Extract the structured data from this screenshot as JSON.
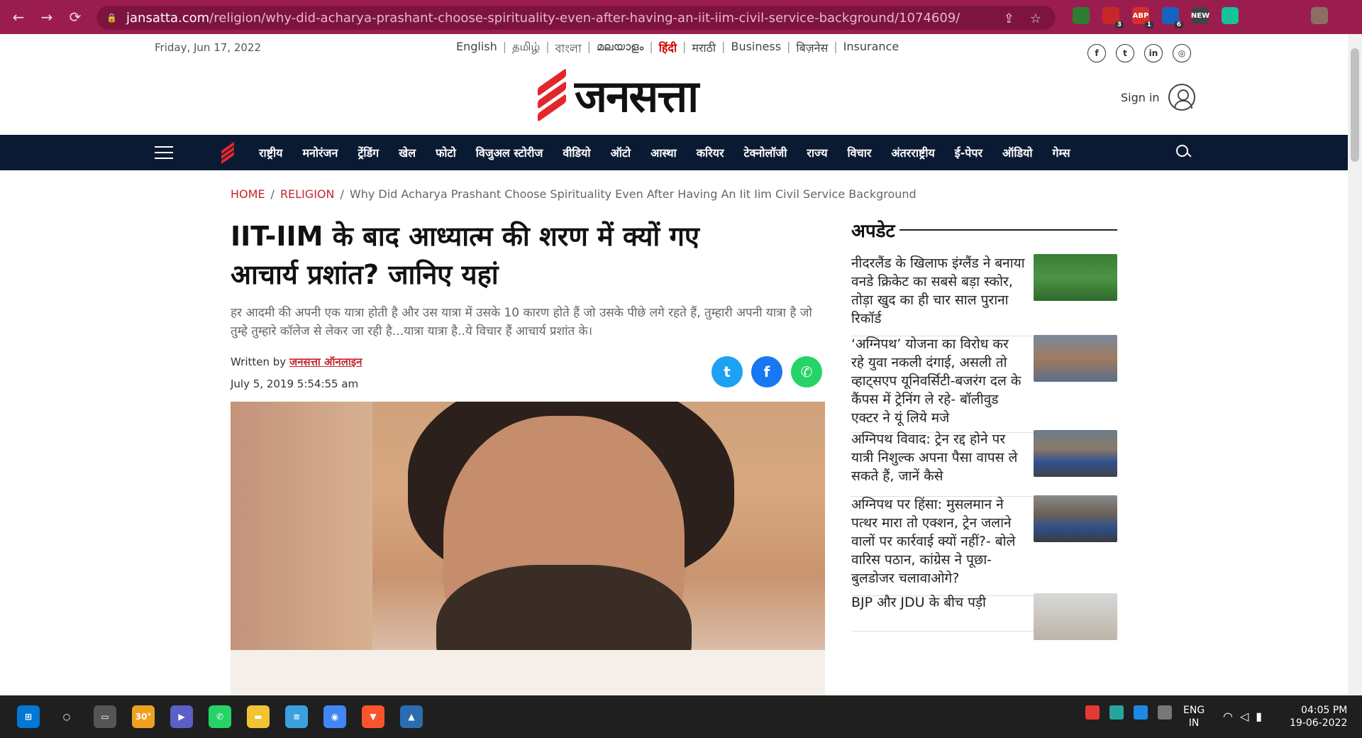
{
  "browser": {
    "url_host": "jansatta.com",
    "url_path": "/religion/why-did-acharya-prashant-choose-spirituality-even-after-having-an-iit-iim-civil-service-background/1074609/",
    "extensions": [
      {
        "icon": "globe-ext-icon",
        "color": "#2e7d32",
        "badge": ""
      },
      {
        "icon": "shield-ext-icon",
        "color": "#c62828",
        "badge": "3"
      },
      {
        "icon": "adblock-ext-icon",
        "color": "#d32f2f",
        "badge": "1",
        "label": "ABP"
      },
      {
        "icon": "mail-ext-icon",
        "color": "#1565c0",
        "badge": "6"
      },
      {
        "icon": "new-ext-icon",
        "color": "#424242",
        "badge": "",
        "label": "NEW"
      },
      {
        "icon": "grammarly-ext-icon",
        "color": "#15c39a",
        "badge": ""
      },
      {
        "icon": "puzzle-icon",
        "color": "#9b1d4f",
        "badge": ""
      },
      {
        "icon": "sidepanel-icon",
        "color": "#9b1d4f",
        "badge": ""
      },
      {
        "icon": "profile-avatar-icon",
        "color": "#8d6e63",
        "badge": ""
      }
    ]
  },
  "header": {
    "date": "Friday, Jun 17, 2022",
    "languages": [
      "English",
      "தமிழ்",
      "বাংলা",
      "മലയാളം",
      "हिंदी",
      "मराठी",
      "Business",
      "बिज़नेस",
      "Insurance"
    ],
    "active_language": "हिंदी",
    "logo_text": "जनसत्ता",
    "sign_in": "Sign in",
    "social": [
      "f",
      "t",
      "in",
      "ig"
    ]
  },
  "nav": {
    "items": [
      "राष्ट्रीय",
      "मनोरंजन",
      "ट्रेंडिंग",
      "खेल",
      "फोटो",
      "विजुअल स्टोरीज",
      "वीडियो",
      "ऑटो",
      "आस्था",
      "करियर",
      "टेक्नोलॉजी",
      "राज्य",
      "विचार",
      "अंतरराष्ट्रीय",
      "ई-पेपर",
      "ऑडियो",
      "गेम्स"
    ]
  },
  "article": {
    "breadcrumb": {
      "home": "HOME",
      "section": "RELIGION",
      "current": "Why Did Acharya Prashant Choose Spirituality Even After Having An Iit Iim Civil Service Background"
    },
    "headline": "IIT-IIM के बाद आध्यात्म की शरण में क्यों गए आचार्य प्रशांत? जानिए यहां",
    "summary": "हर आदमी की अपनी एक यात्रा होती है और उस यात्रा में उसके 10 कारण होते हैं जो उसके पीछे लगे रहते हैं, तुम्हारी अपनी यात्रा है जो तुम्हे तुम्हारे कॉलेज से लेकर जा रही है...यात्रा यात्रा है..ये विचार हैं आचार्य प्रशांत के।",
    "written_by_label": "Written by",
    "author": "जनसत्ता ऑनलाइन",
    "published": "July 5, 2019 5:54:55 am"
  },
  "sidebar": {
    "title": "अपडेट",
    "items": [
      {
        "text": "नीदरलैंड के खिलाफ इंग्लैंड ने बनाया वनडे क्रिकेट का सबसे बड़ा स्कोर, तोड़ा खुद का ही चार साल पुराना रिकॉर्ड"
      },
      {
        "text": "‘अग्निपथ’ योजना का विरोध कर रहे युवा नकली दंगाई, असली तो व्हाट्सएप यूनिवर्सिटी-बजरंग दल के कैंपस में ट्रेनिंग ले रहे- बॉलीवुड एक्टर ने यूं लिये मजे"
      },
      {
        "text": "अग्निपथ विवाद: ट्रेन रद्द होने पर यात्री निशुल्क अपना पैसा वापस ले सकते हैं, जानें कैसे"
      },
      {
        "text": "अग्निपथ पर हिंसा: मुसलमान ने पत्थर मारा तो एक्शन, ट्रेन जलाने वालों पर कार्रवाई क्यों नहीं?- बोले वारिस पठान, कांग्रेस ने पूछा- बुलडोजर चलावाओगे?"
      },
      {
        "text": "BJP और JDU के बीच पड़ी"
      }
    ]
  },
  "taskbar": {
    "weather": "30°",
    "lang_line1": "ENG",
    "lang_line2": "IN",
    "time": "04:05 PM",
    "date": "19-06-2022"
  }
}
